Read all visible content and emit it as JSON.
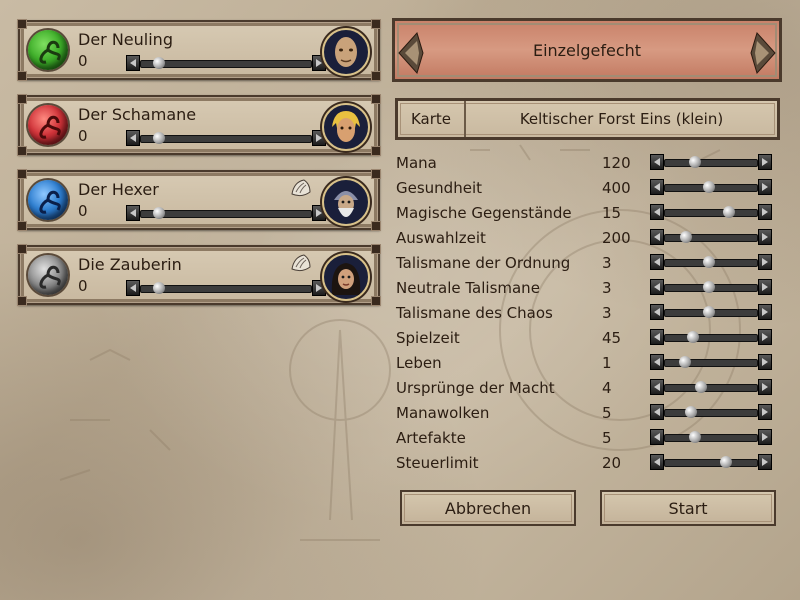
{
  "players": [
    {
      "name": "Der Neuling",
      "score": "0",
      "orb_color": "#3fae2a",
      "orb_dark": "#16600e",
      "slider": 0.08,
      "portrait_icon": "bald-man-portrait",
      "shell": false
    },
    {
      "name": "Der Schamane",
      "score": "0",
      "orb_color": "#d0343a",
      "orb_dark": "#6e0d12",
      "slider": 0.08,
      "portrait_icon": "blond-warrior-portrait",
      "shell": false
    },
    {
      "name": "Der Hexer",
      "score": "0",
      "orb_color": "#2f7fd0",
      "orb_dark": "#0d3470",
      "slider": 0.08,
      "portrait_icon": "bearded-wizard-portrait",
      "shell": true
    },
    {
      "name": "Die Zauberin",
      "score": "0",
      "orb_color": "#8f8f8f",
      "orb_dark": "#3a3a3a",
      "slider": 0.08,
      "portrait_icon": "dark-haired-woman-portrait",
      "shell": true
    }
  ],
  "mode_title": "Einzelgefecht",
  "map": {
    "label": "Karte",
    "value": "Keltischer Forst Eins (klein)"
  },
  "settings": [
    {
      "label": "Mana",
      "value": "120",
      "slider": 0.3
    },
    {
      "label": "Gesundheit",
      "value": "400",
      "slider": 0.48
    },
    {
      "label": "Magische Gegenstände",
      "value": "15",
      "slider": 0.72
    },
    {
      "label": "Auswahlzeit",
      "value": "200",
      "slider": 0.2
    },
    {
      "label": "Talismane der Ordnung",
      "value": "3",
      "slider": 0.48
    },
    {
      "label": "Neutrale Talismane",
      "value": "3",
      "slider": 0.48
    },
    {
      "label": "Talismane des Chaos",
      "value": "3",
      "slider": 0.48
    },
    {
      "label": "Spielzeit",
      "value": "45",
      "slider": 0.28
    },
    {
      "label": "Leben",
      "value": "1",
      "slider": 0.18
    },
    {
      "label": "Ursprünge der Macht",
      "value": "4",
      "slider": 0.38
    },
    {
      "label": "Manawolken",
      "value": "5",
      "slider": 0.25
    },
    {
      "label": "Artefakte",
      "value": "5",
      "slider": 0.3
    },
    {
      "label": "Steuerlimit",
      "value": "20",
      "slider": 0.68
    }
  ],
  "buttons": {
    "cancel": "Abbrechen",
    "start": "Start"
  }
}
